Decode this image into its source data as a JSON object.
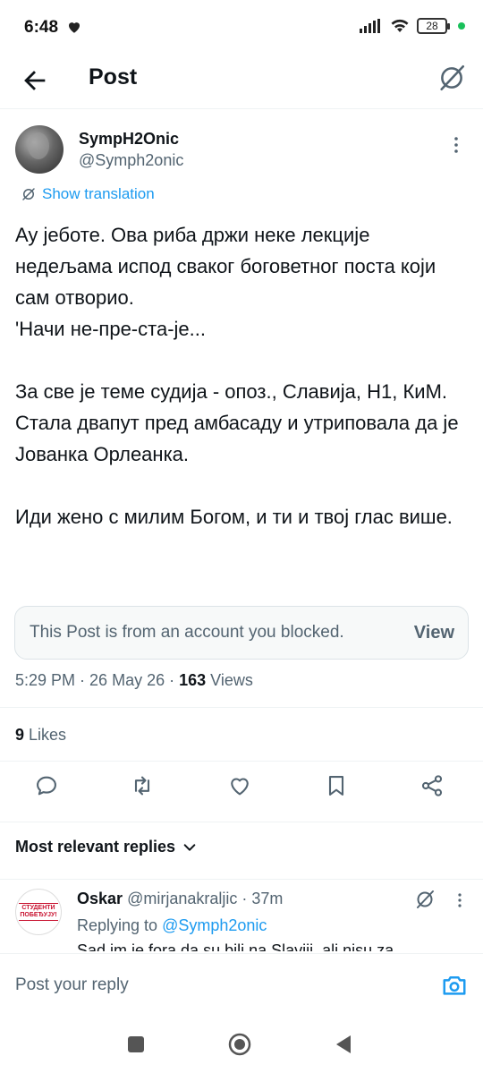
{
  "status_bar": {
    "time": "6:48",
    "battery": "28"
  },
  "header": {
    "title": "Post"
  },
  "post": {
    "display_name": "SympH2Onic",
    "handle": "@Symph2onic",
    "show_translation": "Show translation",
    "text": "Ау јеботе. Ова риба држи неке лекције недељама испод сваког боговетног поста који сам отворио.\n'Начи не-пре-ста-је...\n\nЗа све је теме судија - опоз., Славија, Н1, КиМ.\nСтала двапут пред амбасаду и утриповала да је Јованка Орлеанка.\n\nИди жено с милим Богом, и ти и твој глас више.",
    "blocked_notice": "This Post is from an account you blocked.",
    "blocked_view": "View",
    "time": "5:29 PM",
    "date": "26 May 26",
    "views_count": "163",
    "views_label": "Views",
    "likes_count": "9",
    "likes_label": "Likes"
  },
  "replies": {
    "sort_label": "Most relevant replies",
    "items": [
      {
        "name": "Oskar",
        "handle": "@mirjanakraljic",
        "age": "37m",
        "replying_label": "Replying to",
        "replying_to": "@Symph2onic",
        "text_preview": "Sad im je fora da su bili na Slaviji, ali nisu za",
        "avatar_text": "СТУДЕНТИ ПОБЕЂУЈУ!"
      }
    ]
  },
  "compose": {
    "placeholder": "Post your reply"
  },
  "colors": {
    "accent": "#1d9bf0",
    "text": "#0f1419",
    "secondary": "#536471"
  },
  "icons": [
    "back-arrow-icon",
    "grok-icon",
    "more-icon",
    "translate-icon",
    "reply-icon",
    "repost-icon",
    "like-icon",
    "bookmark-icon",
    "share-icon",
    "chevron-down-icon",
    "camera-icon"
  ]
}
